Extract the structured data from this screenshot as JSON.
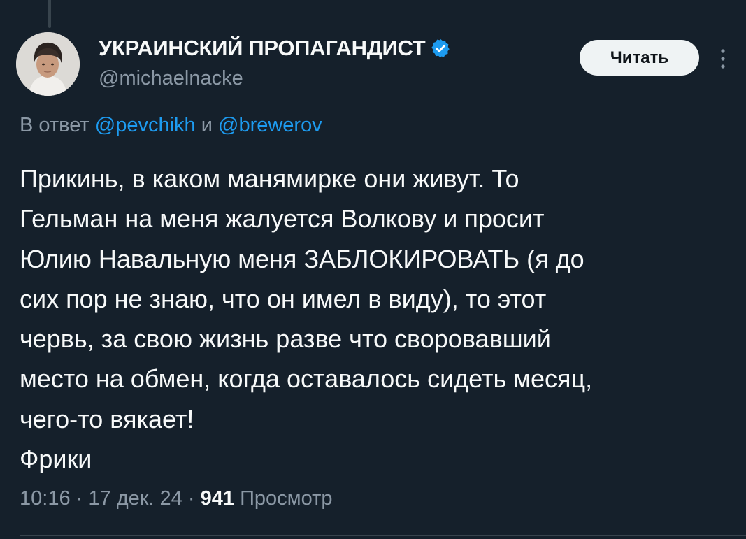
{
  "author": {
    "display_name": "УКРАИНСКИЙ ПРОПАГАНДИСТ",
    "handle": "@michaelnacke",
    "verified": true,
    "verified_color": "#1d9bf0"
  },
  "actions": {
    "read_label": "Читать",
    "more_icon": "more-vertical-icon"
  },
  "reply": {
    "prefix": "В ответ",
    "mention_1": "@pevchikh",
    "conjunction": "и",
    "mention_2": "@brewerov"
  },
  "tweet": {
    "lines": [
      "Прикинь, в каком манямирке они живут. То",
      "Гельман на меня жалуется Волкову и просит",
      "Юлию Навальную меня ЗАБЛОКИРОВАТЬ (я до",
      "сих пор не знаю, что он имел в виду), то этот",
      "червь, за свою жизнь разве что своровавший",
      "место на обмен, когда оставалось сидеть месяц,",
      "чего-то вякает!",
      "Фрики"
    ]
  },
  "meta": {
    "time": "10:16",
    "separator": "·",
    "date": "17 дек. 24",
    "views_count": "941",
    "views_label": "Просмотр"
  },
  "colors": {
    "background": "#15202b",
    "text_primary": "#f7f9f9",
    "text_secondary": "#8b98a5",
    "accent": "#1d9bf0"
  }
}
